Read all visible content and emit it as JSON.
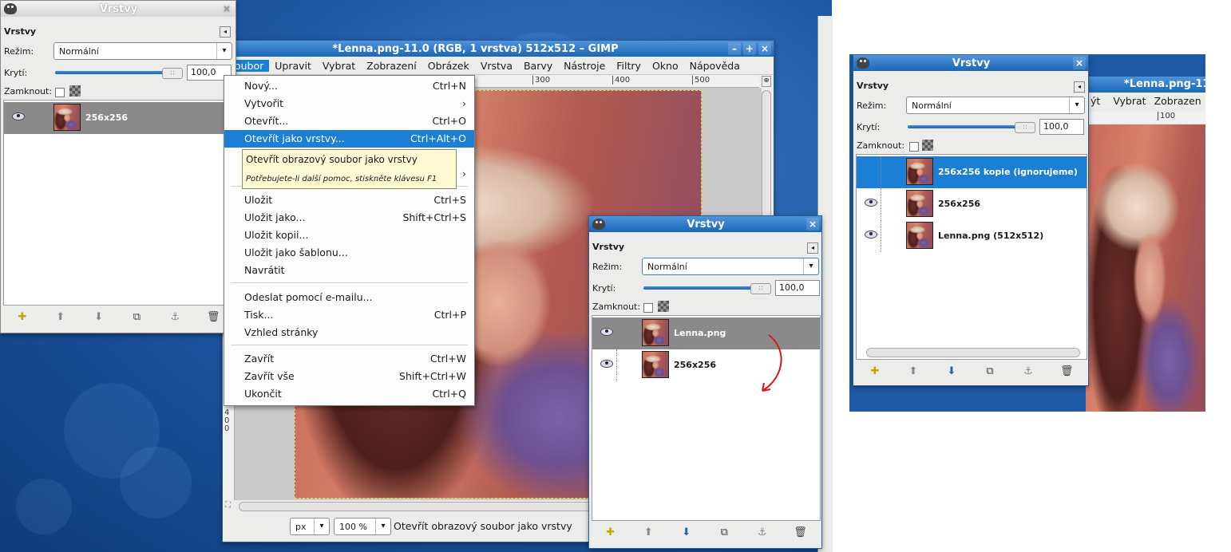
{
  "layers_left": {
    "title": "Vrstvy",
    "tab_label": "Vrstvy",
    "mode_label": "Režim:",
    "mode_value": "Normální",
    "opacity_label": "Krytí:",
    "opacity_value": "100,0",
    "lock_label": "Zamknout:",
    "layers": [
      {
        "name": "256x256"
      }
    ]
  },
  "main": {
    "title": "*Lenna.png-11.0 (RGB, 1 vrstva) 512x512 – GIMP",
    "menubar": [
      "Soubor",
      "Upravit",
      "Vybrat",
      "Zobrazení",
      "Obrázek",
      "Vrstva",
      "Barvy",
      "Nástroje",
      "Filtry",
      "Okno",
      "Nápověda"
    ],
    "ruler_ticks": [
      "300",
      "400",
      "500"
    ],
    "ruler_vert": "4\n0\n0",
    "unit": "px",
    "zoom": "100 %",
    "status_text": "Otevřít obrazový soubor jako vrstvy"
  },
  "file_menu": {
    "items": [
      {
        "label": "Nový...",
        "shortcut": "Ctrl+N"
      },
      {
        "label": "Vytvořit",
        "shortcut": "›"
      },
      {
        "label": "Otevřít...",
        "shortcut": "Ctrl+O"
      },
      {
        "label": "Otevřít jako vrstvy...",
        "shortcut": "Ctrl+Alt+O"
      },
      {
        "label": "Uložit",
        "shortcut": "Ctrl+S"
      },
      {
        "label": "Uložit jako...",
        "shortcut": "Shift+Ctrl+S"
      },
      {
        "label": "Uložit kopii...",
        "shortcut": ""
      },
      {
        "label": "Uložit jako šablonu...",
        "shortcut": ""
      },
      {
        "label": "Navrátit",
        "shortcut": ""
      },
      {
        "label": "Odeslat pomocí e-mailu...",
        "shortcut": ""
      },
      {
        "label": "Tisk...",
        "shortcut": "Ctrl+P"
      },
      {
        "label": "Vzhled stránky",
        "shortcut": ""
      },
      {
        "label": "Zavřít",
        "shortcut": "Ctrl+W"
      },
      {
        "label": "Zavřít vše",
        "shortcut": "Shift+Ctrl+W"
      },
      {
        "label": "Ukončit",
        "shortcut": "Ctrl+Q"
      }
    ],
    "tooltip_title": "Otevřít obrazový soubor jako vrstvy",
    "tooltip_help": "Potřebujete-li další pomoc, stiskněte klávesu F1",
    "submenu_arrow": "›"
  },
  "layers_mid": {
    "title": "Vrstvy",
    "tab_label": "Vrstvy",
    "mode_label": "Režim:",
    "mode_value": "Normální",
    "opacity_label": "Krytí:",
    "opacity_value": "100,0",
    "lock_label": "Zamknout:",
    "layers": [
      {
        "name": "Lenna.png"
      },
      {
        "name": "256x256"
      }
    ]
  },
  "layers_right": {
    "title": "Vrstvy",
    "tab_label": "Vrstvy",
    "mode_label": "Režim:",
    "mode_value": "Normální",
    "opacity_label": "Krytí:",
    "opacity_value": "100,0",
    "lock_label": "Zamknout:",
    "layers": [
      {
        "name": "256x256 kopie (ignorujeme)"
      },
      {
        "name": "256x256"
      },
      {
        "name": "Lenna.png (512x512)"
      }
    ],
    "bg_title": "*Lenna.png-11",
    "bg_menu": [
      "ýt",
      "Vybrat",
      "Zobrazen"
    ],
    "bg_ruler": "100"
  },
  "colors": {
    "accent": "#1c7fd6",
    "annotation_arrow": "#d81818"
  }
}
